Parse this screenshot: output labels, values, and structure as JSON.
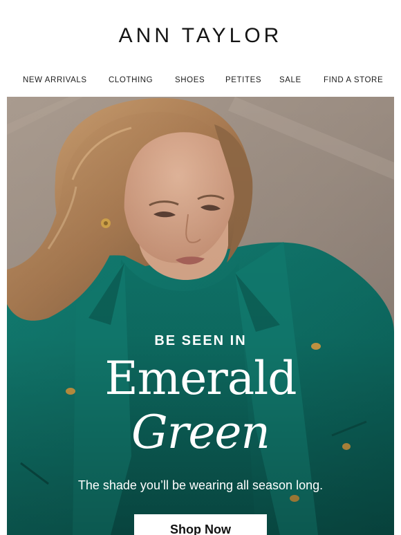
{
  "header": {
    "logo": "ANN TAYLOR",
    "nav": [
      {
        "label": "NEW ARRIVALS"
      },
      {
        "label": "CLOTHING"
      },
      {
        "label": "SHOES"
      },
      {
        "label": "PETITES"
      },
      {
        "label": "SALE"
      },
      {
        "label": "FIND A STORE"
      }
    ]
  },
  "hero": {
    "eyebrow": "BE SEEN IN",
    "headline_line1": "Emerald",
    "headline_line2": "Green",
    "subcopy": "The shade you’ll be wearing all season long.",
    "cta_label": "Shop Now",
    "image_subject": "woman-in-emerald-green-jacket-photo"
  },
  "colors": {
    "emerald": "#0f6d64",
    "background_stone": "#9c8f84",
    "text_dark": "#141414",
    "text_light": "#ffffff"
  }
}
